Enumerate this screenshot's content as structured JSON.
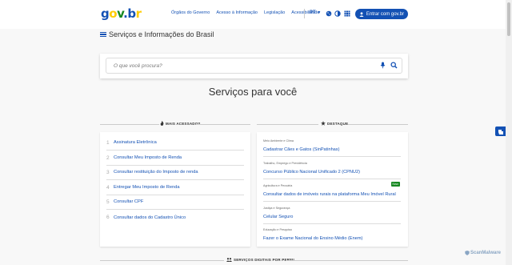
{
  "header": {
    "logo": {
      "g": "g",
      "o": "o",
      "v": "v",
      "dot": ".",
      "b": "b",
      "r": "r"
    },
    "nav": [
      "Órgãos do Governo",
      "Acesso à Informação",
      "Legislação",
      "Acessibilidade"
    ],
    "lang": "PT",
    "login_label": "Entrar com gov.br"
  },
  "menu": {
    "title": "Serviços e Informações do Brasil"
  },
  "search": {
    "placeholder": "O que você procura?"
  },
  "services_title": "Serviços para você",
  "mais_acessados": {
    "heading": "MAIS ACESSADOS",
    "items": [
      {
        "num": "1",
        "label": "Assinatura Eletrônica"
      },
      {
        "num": "2",
        "label": "Consultar Meu Imposto de Renda"
      },
      {
        "num": "3",
        "label": "Consultar restituição do Imposto de renda"
      },
      {
        "num": "4",
        "label": "Entregar Meu Imposto de Renda"
      },
      {
        "num": "5",
        "label": "Consultar CPF"
      },
      {
        "num": "6",
        "label": "Consultar dados do Cadastro Único"
      }
    ]
  },
  "destaque": {
    "heading": "DESTAQUE",
    "items": [
      {
        "category": "Meio Ambiente e Clima",
        "label": "Cadastrar Cães e Gatos (SinPatinhas)",
        "badge": ""
      },
      {
        "category": "Trabalho, Emprego e Previdência",
        "label": "Concurso Público Nacional Unificado 2 (CPNU2)",
        "badge": ""
      },
      {
        "category": "Agricultura e Pecuária",
        "label": "Consultar dados de imóveis rurais na plataforma Meu Imóvel Rural",
        "badge": "Novo"
      },
      {
        "category": "Justiça e Segurança",
        "label": "Celular Seguro",
        "badge": ""
      },
      {
        "category": "Educação e Pesquisa",
        "label": "Fazer o Exame Nacional do Ensino Médio (Enem)",
        "badge": ""
      }
    ]
  },
  "bottom_heading": "SERVIÇOS DIGITAIS POR PERFIL",
  "watermark": "ScanMalware",
  "colors": {
    "primary": "#1351b4",
    "logo_green": "#168821",
    "logo_yellow": "#ffcd07",
    "logo_blue": "#1351b4",
    "badge": "#168821"
  },
  "icons": [
    "hamburger-icon",
    "mic-icon",
    "search-icon",
    "cookie-icon",
    "contrast-icon",
    "apps-icon",
    "user-icon",
    "fire-icon",
    "star-icon",
    "people-icon",
    "vlibras-icon"
  ]
}
